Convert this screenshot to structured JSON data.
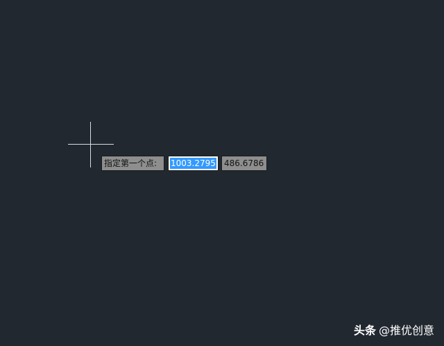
{
  "dynamic_input": {
    "prompt": "指定第一个点:",
    "x_value": "1003.2795",
    "y_value": "486.6786"
  },
  "watermark": {
    "brand": "头条",
    "handle": "@推优创意"
  },
  "colors": {
    "background": "#212830",
    "crosshair": "#d9dde2",
    "selection": "#3399ff",
    "tooltip": "#8e8e8e"
  },
  "icons": {
    "cursor": "crosshair-cursor-icon"
  }
}
